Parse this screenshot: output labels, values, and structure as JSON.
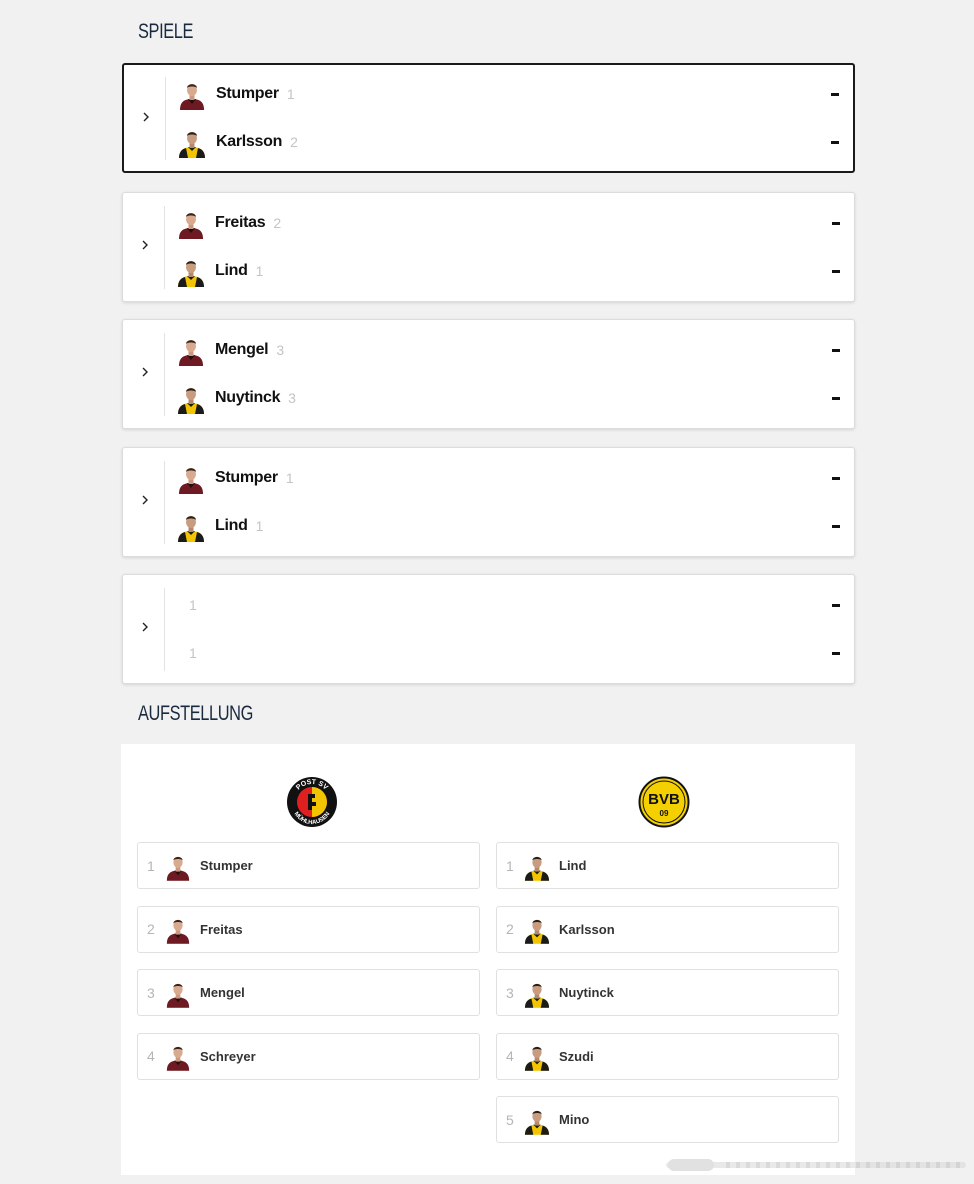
{
  "sections": {
    "games_title": "SPIELE",
    "lineup_title": "AUFSTELLUNG"
  },
  "colors": {
    "home_shirt": "#7a1c24",
    "away_shirt": "#f2c500",
    "away_dark": "#1b1b1b",
    "title": "#1a2a3e"
  },
  "games": [
    {
      "active": true,
      "home": {
        "name": "Stumper",
        "number": "1",
        "score": "-"
      },
      "away": {
        "name": "Karlsson",
        "number": "2",
        "score": "-"
      }
    },
    {
      "active": false,
      "home": {
        "name": "Freitas",
        "number": "2",
        "score": "-"
      },
      "away": {
        "name": "Lind",
        "number": "1",
        "score": "-"
      }
    },
    {
      "active": false,
      "home": {
        "name": "Mengel",
        "number": "3",
        "score": "-"
      },
      "away": {
        "name": "Nuytinck",
        "number": "3",
        "score": "-"
      }
    },
    {
      "active": false,
      "home": {
        "name": "Stumper",
        "number": "1",
        "score": "-"
      },
      "away": {
        "name": "Lind",
        "number": "1",
        "score": "-"
      }
    },
    {
      "active": false,
      "home": {
        "name": "",
        "number": "1",
        "score": "-"
      },
      "away": {
        "name": "",
        "number": "1",
        "score": "-"
      }
    }
  ],
  "lineup": {
    "home_crest": {
      "icon": "post-sv-muehlhausen-crest",
      "text_top": "POST SV",
      "text_bottom": "MÜHLHAUSEN"
    },
    "away_crest": {
      "icon": "bvb-09-crest",
      "text_top": "BVB",
      "text_bottom": "09"
    },
    "home": [
      {
        "number": "1",
        "name": "Stumper"
      },
      {
        "number": "2",
        "name": "Freitas"
      },
      {
        "number": "3",
        "name": "Mengel"
      },
      {
        "number": "4",
        "name": "Schreyer"
      }
    ],
    "away": [
      {
        "number": "1",
        "name": "Lind"
      },
      {
        "number": "2",
        "name": "Karlsson"
      },
      {
        "number": "3",
        "name": "Nuytinck"
      },
      {
        "number": "4",
        "name": "Szudi"
      },
      {
        "number": "5",
        "name": "Mino"
      }
    ]
  }
}
